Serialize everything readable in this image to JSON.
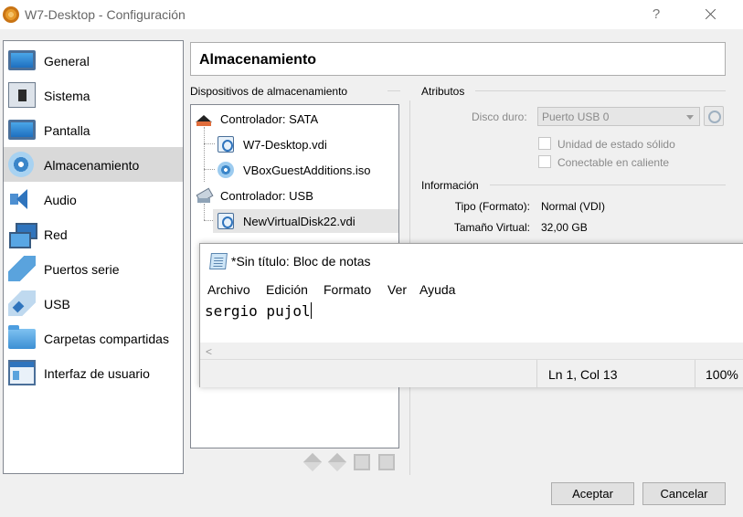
{
  "window": {
    "title": "W7-Desktop - Configuración",
    "help_glyph": "?",
    "close_icon": "close-icon"
  },
  "sidebar": {
    "items": [
      {
        "label": "General",
        "icon": "monitor-icon"
      },
      {
        "label": "Sistema",
        "icon": "chip-icon"
      },
      {
        "label": "Pantalla",
        "icon": "display-icon"
      },
      {
        "label": "Almacenamiento",
        "icon": "disk-icon",
        "selected": true
      },
      {
        "label": "Audio",
        "icon": "speaker-icon"
      },
      {
        "label": "Red",
        "icon": "network-icon"
      },
      {
        "label": "Puertos serie",
        "icon": "serial-port-icon"
      },
      {
        "label": "USB",
        "icon": "usb-icon"
      },
      {
        "label": "Carpetas compartidas",
        "icon": "folder-icon"
      },
      {
        "label": "Interfaz de usuario",
        "icon": "user-interface-icon"
      }
    ]
  },
  "header": {
    "title": "Almacenamiento"
  },
  "storage": {
    "heading": "Dispositivos de almacenamiento",
    "tree": [
      {
        "label": "Controlador: SATA",
        "level": 0,
        "icon": "sata-controller-icon"
      },
      {
        "label": "W7-Desktop.vdi",
        "level": 1,
        "icon": "hard-disk-icon"
      },
      {
        "label": "VBoxGuestAdditions.iso",
        "level": 1,
        "icon": "optical-disc-icon"
      },
      {
        "label": "Controlador: USB",
        "level": 0,
        "icon": "usb-controller-icon"
      },
      {
        "label": "NewVirtualDisk22.vdi",
        "level": 1,
        "icon": "hard-disk-icon",
        "selected": true
      }
    ]
  },
  "attributes": {
    "heading": "Atributos",
    "hard_disk_label": "Disco duro:",
    "hard_disk_value": "Puerto USB 0",
    "ssd_label": "Unidad de estado sólido",
    "ssd_checked": false,
    "hotplug_label": "Conectable en caliente",
    "hotplug_checked": false
  },
  "information": {
    "heading": "Información",
    "rows": [
      {
        "key": "Tipo (Formato):",
        "value": "Normal (VDI)"
      },
      {
        "key": "Tamaño Virtual:",
        "value": "32,00 GB"
      }
    ]
  },
  "notepad": {
    "title": "*Sin título: Bloc de notas",
    "menu": [
      "Archivo",
      "Edición",
      "Formato",
      "Ver",
      "Ayuda"
    ],
    "text": "sergio pujol",
    "scroll_left": "<",
    "status_position": "Ln 1, Col 13",
    "status_zoom": "100%"
  },
  "buttons": {
    "accept": "Aceptar",
    "cancel": "Cancelar"
  }
}
